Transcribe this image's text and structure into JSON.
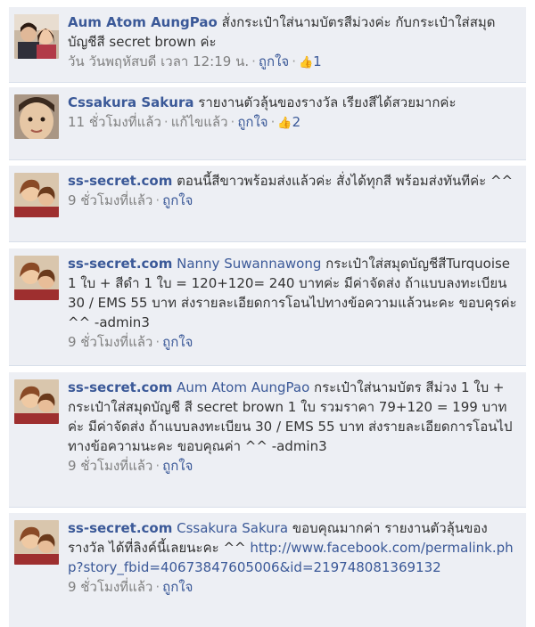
{
  "comments": [
    {
      "author": "Aum Atom AungPao",
      "mention": "",
      "text": "สั่งกระเป๋าใส่นามบัตรสีม่วงค่ะ กับกระเป๋าใส่สมุดบัญชีสี secret brown ค่ะ",
      "link": "",
      "time": "วัน วันพฤหัสบดี เวลา 12:19 น.",
      "edited": "",
      "like_label": "ถูกใจ",
      "like_count": "1",
      "avatar": "couple-photo"
    },
    {
      "author": "Cssakura Sakura",
      "mention": "",
      "text": "รายงานตัวลุ้นของรางวัล เรียงสีได้สวยมากค่ะ",
      "link": "",
      "time": "11 ชั่วโมงที่แล้ว",
      "edited": "แก้ไขแล้ว",
      "like_label": "ถูกใจ",
      "like_count": "2",
      "avatar": "child-photo"
    },
    {
      "author": "ss-secret.com",
      "mention": "",
      "text": "ตอนนี้สีขาวพร้อมส่งแล้วค่ะ สั่งได้ทุกสี พร้อมส่งทันทีค่ะ ^^",
      "link": "",
      "time": "9 ชั่วโมงที่แล้ว",
      "edited": "",
      "like_label": "ถูกใจ",
      "like_count": "",
      "avatar": "page-photo"
    },
    {
      "author": "ss-secret.com",
      "mention": "Nanny Suwannawong",
      "text": "กระเป๋าใส่สมุดบัญชีสีTurquoise 1 ใบ + สีดำ 1 ใบ = 120+120= 240 บาทค่ะ มีค่าจัดส่ง ถ้าแบบลงทะเบียน 30 / EMS 55 บาท ส่งรายละเอียดการโอนไปทางข้อความแล้วนะคะ ขอบคุรค่ะ ^^ -admin3",
      "link": "",
      "time": "9 ชั่วโมงที่แล้ว",
      "edited": "",
      "like_label": "ถูกใจ",
      "like_count": "",
      "avatar": "page-photo"
    },
    {
      "author": "ss-secret.com",
      "mention": "Aum Atom AungPao",
      "text": "กระเป๋าใส่นามบัตร สีม่วง 1 ใบ + กระเป๋าใส่สมุดบัญชี สี secret brown 1 ใบ รวมราคา 79+120 = 199 บาทค่ะ มีค่าจัดส่ง ถ้าแบบลงทะเบียน 30 / EMS 55 บาท ส่งรายละเอียดการโอนไปทางข้อความนะคะ ขอบคุณค่า ^^ -admin3",
      "link": "",
      "time": "9 ชั่วโมงที่แล้ว",
      "edited": "",
      "like_label": "ถูกใจ",
      "like_count": "",
      "avatar": "page-photo"
    },
    {
      "author": "ss-secret.com",
      "mention": "Cssakura Sakura",
      "text": "ขอบคุณมากค่า รายงานตัวลุ้นของรางวัล ได้ที่ลิงค์นี้เลยนะคะ ^^",
      "link": "http://www.facebook.com/permalink.php?story_fbid=40673847605006&id=219748081369132",
      "time": "9 ชั่วโมงที่แล้ว",
      "edited": "",
      "like_label": "ถูกใจ",
      "like_count": "",
      "avatar": "page-photo"
    }
  ],
  "colors": {
    "link": "#3b5998",
    "comment_bg": "#edeff4",
    "meta": "#808080",
    "divider": "#d8dfea"
  },
  "icons": {
    "like": "thumbs-up-icon",
    "separator": "middle-dot"
  }
}
